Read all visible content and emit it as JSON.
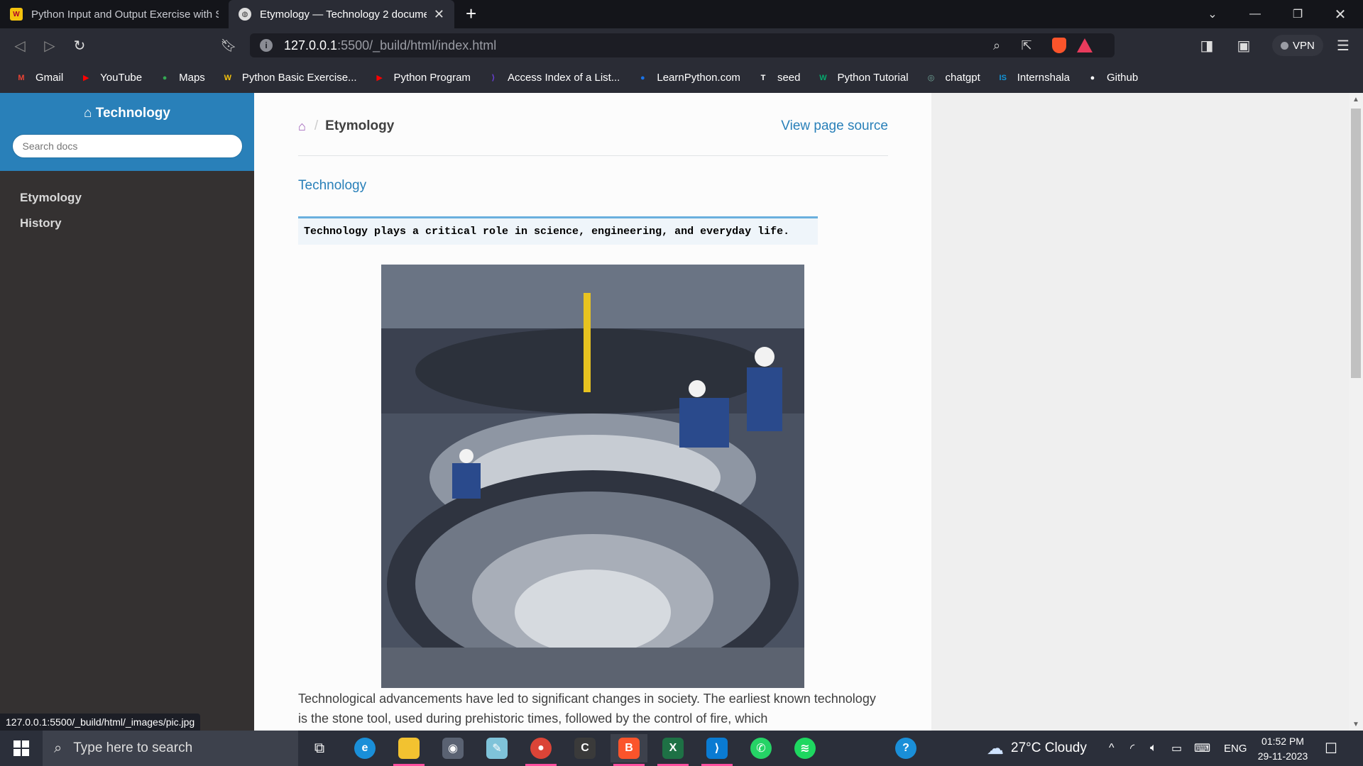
{
  "browser": {
    "tabs": [
      {
        "title": "Python Input and Output Exercise with So",
        "active": false
      },
      {
        "title": "Etymology — Technology 2 docume",
        "active": true
      }
    ],
    "url_host": "127.0.0.1",
    "url_path": ":5500/_build/html/index.html",
    "vpn_label": "VPN",
    "bookmarks": [
      {
        "label": "Gmail",
        "icon": "gmail-icon",
        "color": "#ea4335",
        "glyph": "M"
      },
      {
        "label": "YouTube",
        "icon": "youtube-icon",
        "color": "#ff0000",
        "glyph": "▶"
      },
      {
        "label": "Maps",
        "icon": "maps-icon",
        "color": "#34a853",
        "glyph": "●"
      },
      {
        "label": "Python Basic Exercise...",
        "icon": "w3resource-icon",
        "color": "#f4c20d",
        "glyph": "W"
      },
      {
        "label": "Python Program",
        "icon": "youtube-icon",
        "color": "#ff0000",
        "glyph": "▶"
      },
      {
        "label": "Access Index of a List...",
        "icon": "site-icon",
        "color": "#6a3fd9",
        "glyph": "⟩"
      },
      {
        "label": "LearnPython.com",
        "icon": "learnpython-icon",
        "color": "#1a73e8",
        "glyph": "●"
      },
      {
        "label": "seed",
        "icon": "seed-icon",
        "color": "#ffffff",
        "glyph": "T"
      },
      {
        "label": "Python Tutorial",
        "icon": "w3schools-icon",
        "color": "#04aa6d",
        "glyph": "W"
      },
      {
        "label": "chatgpt",
        "icon": "chatgpt-icon",
        "color": "#74aa9c",
        "glyph": "◎"
      },
      {
        "label": "Internshala",
        "icon": "internshala-icon",
        "color": "#1295d8",
        "glyph": "IS"
      },
      {
        "label": "Github",
        "icon": "github-icon",
        "color": "#ffffff",
        "glyph": "●"
      }
    ],
    "status_url": "127.0.0.1:5500/_build/html/_images/pic.jpg"
  },
  "sidebar": {
    "project": "Technology",
    "search_placeholder": "Search docs",
    "items": [
      "Etymology",
      "History"
    ]
  },
  "main": {
    "breadcrumb_current": "Etymology",
    "view_source": "View page source",
    "heading_link": "Technology",
    "code": "Technology plays a critical role in science, engineering, and everyday life.",
    "paragraph": "Technological advancements have led to significant changes in society. The earliest known technology is the stone tool, used during prehistoric times, followed by the control of fire, which"
  },
  "taskbar": {
    "search_placeholder": "Type here to search",
    "weather": "27°C  Cloudy",
    "lang": "ENG",
    "time": "01:52 PM",
    "date": "29-11-2023"
  }
}
